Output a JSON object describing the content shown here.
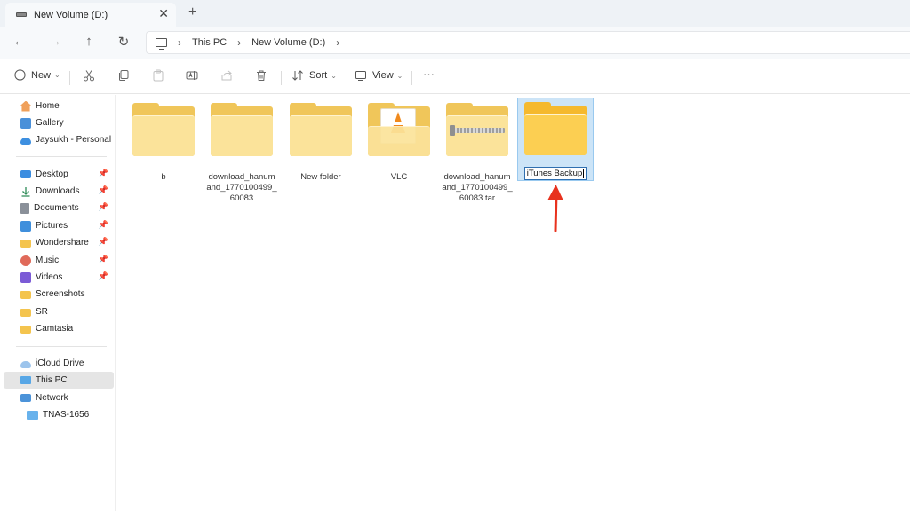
{
  "tab": {
    "title": "New Volume (D:)",
    "close": "✕",
    "new_tab": "+"
  },
  "nav": {
    "back": "←",
    "forward": "→",
    "up": "↑",
    "refresh": "↻"
  },
  "address": {
    "separator": "›",
    "crumbs": [
      "This PC",
      "New Volume (D:)"
    ]
  },
  "commands": {
    "new_label": "New",
    "sort_label": "Sort",
    "view_label": "View",
    "more": "···",
    "caret": "⌄"
  },
  "sidebar": {
    "quick": [
      {
        "label": "Home",
        "icon": "home-icon"
      },
      {
        "label": "Gallery",
        "icon": "gallery-icon"
      },
      {
        "label": "Jaysukh - Personal",
        "icon": "onedrive-icon"
      }
    ],
    "pinned": [
      {
        "label": "Desktop",
        "icon": "desktop-icon",
        "pinned": true
      },
      {
        "label": "Downloads",
        "icon": "download-icon",
        "pinned": true
      },
      {
        "label": "Documents",
        "icon": "document-icon",
        "pinned": true
      },
      {
        "label": "Pictures",
        "icon": "pictures-icon",
        "pinned": true
      },
      {
        "label": "Wondershare",
        "icon": "folder-icon",
        "pinned": true
      },
      {
        "label": "Music",
        "icon": "music-icon",
        "pinned": true
      },
      {
        "label": "Videos",
        "icon": "videos-icon",
        "pinned": true
      },
      {
        "label": "Screenshots",
        "icon": "folder-icon",
        "pinned": false
      },
      {
        "label": "SR",
        "icon": "folder-icon",
        "pinned": false
      },
      {
        "label": "Camtasia",
        "icon": "folder-icon",
        "pinned": false
      }
    ],
    "devices": [
      {
        "label": "iCloud Drive",
        "icon": "icloud-icon"
      },
      {
        "label": "This PC",
        "icon": "this-pc-icon",
        "selected": true
      },
      {
        "label": "Network",
        "icon": "network-icon"
      },
      {
        "label": "TNAS-1656",
        "icon": "nas-icon"
      }
    ],
    "pin_glyph": "📌"
  },
  "items": [
    {
      "name": "b",
      "type": "folder"
    },
    {
      "name": "download_hanumand_1770100499_60083",
      "type": "folder"
    },
    {
      "name": "New folder",
      "type": "folder"
    },
    {
      "name": "VLC",
      "type": "folder-vlc"
    },
    {
      "name": "download_hanumand_1770100499_60083.tar",
      "type": "archive"
    },
    {
      "name": "iTunes Backup",
      "type": "folder",
      "selected": true,
      "renaming": true
    }
  ],
  "colors": {
    "selection": "#cce4f7",
    "folder": "#f0c65a",
    "annotation_arrow": "#e8321e"
  }
}
